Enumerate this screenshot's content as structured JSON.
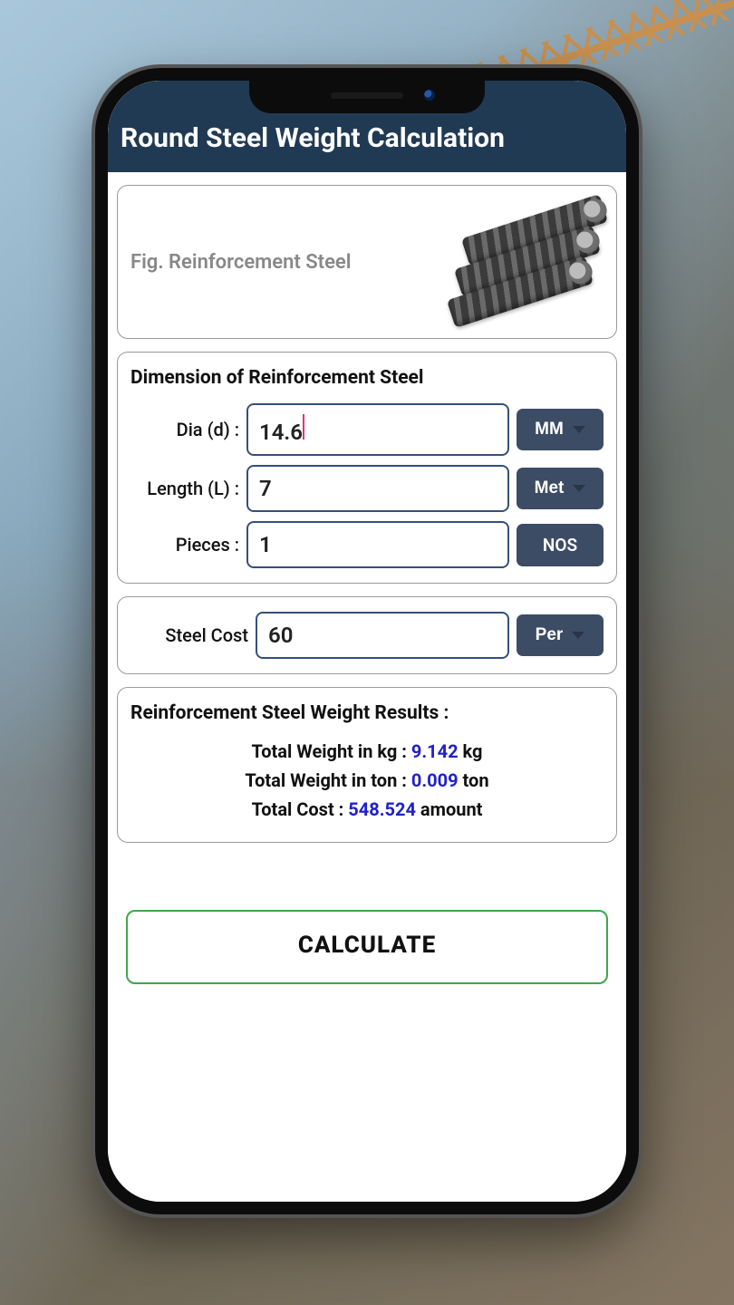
{
  "header": {
    "title": "Round Steel Weight Calculation"
  },
  "figure": {
    "caption": "Fig. Reinforcement Steel"
  },
  "dimensions": {
    "title": "Dimension of Reinforcement Steel",
    "dia": {
      "label": "Dia (d) :",
      "value": "14.6",
      "unit": "MM"
    },
    "length": {
      "label": "Length (L) :",
      "value": "7",
      "unit": "Met"
    },
    "pieces": {
      "label": "Pieces :",
      "value": "1",
      "unit": "NOS"
    }
  },
  "cost": {
    "label": "Steel Cost",
    "value": "60",
    "unit": "Per"
  },
  "results": {
    "title": "Reinforcement Steel Weight Results :",
    "weight_kg": {
      "label_before": "Total Weight in kg : ",
      "value": "9.142",
      "label_after": " kg"
    },
    "weight_ton": {
      "label_before": "Total Weight in ton : ",
      "value": "0.009",
      "label_after": " ton"
    },
    "total_cost": {
      "label_before": "Total Cost : ",
      "value": "548.524",
      "label_after": " amount"
    }
  },
  "actions": {
    "calculate": "CALCULATE"
  }
}
